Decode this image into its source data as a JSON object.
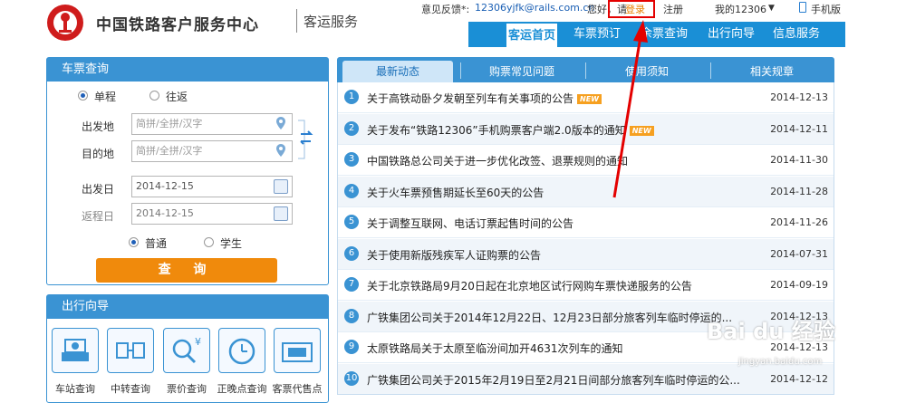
{
  "header": {
    "brand": "中国铁路客户服务中心",
    "subtitle": "客运服务",
    "feedback_label": "意见反馈*:",
    "feedback_email": "12306yjfk@rails.com.cn",
    "greeting": "您好，请",
    "login": "登录",
    "register": "注册",
    "my12306": "我的12306",
    "mobile": "手机版"
  },
  "nav": {
    "items": [
      "客运首页",
      "车票预订",
      "余票查询",
      "出行向导",
      "信息服务"
    ],
    "active_index": 0
  },
  "ticket_query": {
    "title": "车票查询",
    "trip_types": [
      "单程",
      "往返"
    ],
    "from_label": "出发地",
    "to_label": "目的地",
    "station_placeholder": "简拼/全拼/汉字",
    "depart_label": "出发日",
    "depart_date": "2014-12-15",
    "return_label": "返程日",
    "return_date": "2014-12-15",
    "ticket_types": [
      "普通",
      "学生"
    ],
    "query_button": "查 询"
  },
  "guide": {
    "title": "出行向导",
    "items": [
      "车站查询",
      "中转查询",
      "票价查询",
      "正晚点查询",
      "客票代售点"
    ]
  },
  "news": {
    "tabs": [
      "最新动态",
      "购票常见问题",
      "使用须知",
      "相关规章"
    ],
    "active_tab": 0,
    "new_badge": "NEW",
    "items": [
      {
        "num": "1",
        "title": "关于高铁动卧夕发朝至列车有关事项的公告",
        "date": "2014-12-13",
        "new": true
      },
      {
        "num": "2",
        "title": "关于发布“铁路12306”手机购票客户端2.0版本的通知",
        "date": "2014-12-11",
        "new": true
      },
      {
        "num": "3",
        "title": "中国铁路总公司关于进一步优化改签、退票规则的通知",
        "date": "2014-11-30",
        "new": false
      },
      {
        "num": "4",
        "title": "关于火车票预售期延长至60天的公告",
        "date": "2014-11-28",
        "new": false
      },
      {
        "num": "5",
        "title": "关于调整互联网、电话订票起售时间的公告",
        "date": "2014-11-26",
        "new": false
      },
      {
        "num": "6",
        "title": "关于使用新版残疾军人证购票的公告",
        "date": "2014-07-31",
        "new": false
      },
      {
        "num": "7",
        "title": "关于北京铁路局9月20日起在北京地区试行网购车票快递服务的公告",
        "date": "2014-09-19",
        "new": false
      },
      {
        "num": "8",
        "title": "广铁集团公司关于2014年12月22日、12月23日部分旅客列车临时停运的...",
        "date": "2014-12-13",
        "new": false
      },
      {
        "num": "9",
        "title": "太原铁路局关于太原至临汾间加开4631次列车的通知",
        "date": "2014-12-13",
        "new": false
      },
      {
        "num": "10",
        "title": "广铁集团公司关于2015年2月19日至2月21日间部分旅客列车临时停运的公...",
        "date": "2014-12-12",
        "new": false
      }
    ]
  },
  "watermark": {
    "main": "Bai du 经验",
    "sub": "jingyan.baidu.com"
  },
  "colors": {
    "primary": "#3a93d3",
    "accent": "#f08a0c",
    "alert": "#e40000"
  }
}
